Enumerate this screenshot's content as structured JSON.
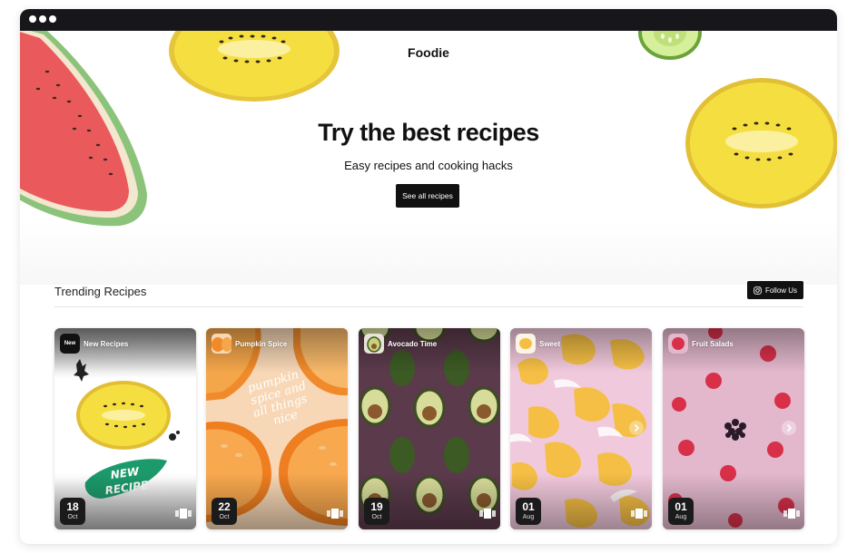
{
  "window": {
    "controls": [
      "close-dot",
      "minimize-dot",
      "maximize-dot"
    ]
  },
  "hero": {
    "brand": "Foodie",
    "title": "Try the best recipes",
    "subtitle": "Easy recipes and cooking hacks",
    "cta_label": "See all recipes"
  },
  "trending": {
    "title": "Trending Recipes",
    "follow_label": "Follow Us",
    "cards": [
      {
        "name": "New Recipes",
        "avatar_text": "New",
        "day": "18",
        "month": "Oct",
        "badge_text": "NEW RECIPE",
        "has_next": false
      },
      {
        "name": "Pumpkin Spice",
        "avatar_text": "",
        "day": "22",
        "month": "Oct",
        "overlay_text_lines": [
          "pumpkin",
          "spice and",
          "all things",
          "nice"
        ],
        "has_next": false
      },
      {
        "name": "Avocado Time",
        "avatar_text": "",
        "day": "19",
        "month": "Oct",
        "has_next": false
      },
      {
        "name": "Sweet",
        "avatar_text": "",
        "day": "01",
        "month": "Aug",
        "has_next": true
      },
      {
        "name": "Fruit Salads",
        "avatar_text": "",
        "day": "01",
        "month": "Aug",
        "has_next": true
      }
    ]
  },
  "colors": {
    "dark": "#111111",
    "watermelon": "#e8595a",
    "kiwi_yellow": "#f3dc3a",
    "pumpkin": "#f08a2a",
    "avocado_bg": "#5b3a4b",
    "sweet_bg": "#f1c9dc",
    "fruit_bg": "#e3b8cd"
  }
}
